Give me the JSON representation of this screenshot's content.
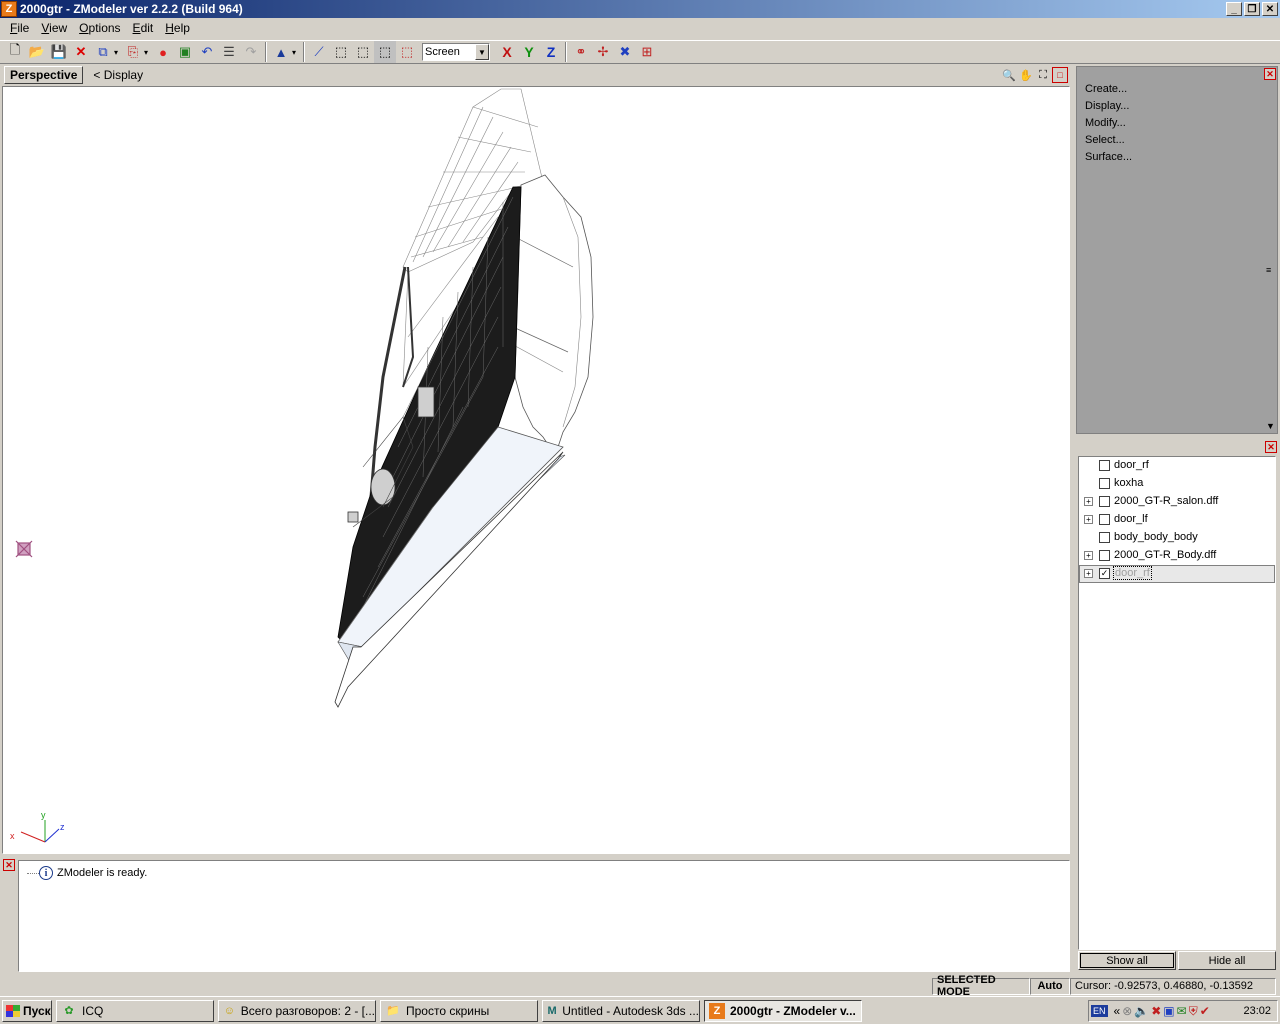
{
  "window": {
    "title": "2000gtr - ZModeler ver 2.2.2 (Build 964)",
    "app_icon": "Z"
  },
  "menu": [
    {
      "label": "File",
      "ul": "F",
      "rest": "ile"
    },
    {
      "label": "View",
      "ul": "V",
      "rest": "iew"
    },
    {
      "label": "Options",
      "ul": "O",
      "rest": "ptions"
    },
    {
      "label": "Edit",
      "ul": "E",
      "rest": "dit"
    },
    {
      "label": "Help",
      "ul": "H",
      "rest": "elp"
    }
  ],
  "toolbar": {
    "projection_select": "Screen",
    "axis_x": "X",
    "axis_y": "Y",
    "axis_z": "Z"
  },
  "viewport": {
    "view_name": "Perspective",
    "display_label": "<  Display",
    "axis_labels": {
      "x": "x",
      "y": "y",
      "z": "z"
    }
  },
  "commands": [
    "Create...",
    "Display...",
    "Modify...",
    "Select...",
    "Surface..."
  ],
  "object_tree": [
    {
      "label": "door_rf",
      "expandable": false,
      "checked": false,
      "selected": false
    },
    {
      "label": "koxha",
      "expandable": false,
      "checked": false,
      "selected": false
    },
    {
      "label": "2000_GT-R_salon.dff",
      "expandable": true,
      "checked": false,
      "selected": false
    },
    {
      "label": "door_lf",
      "expandable": true,
      "checked": false,
      "selected": false
    },
    {
      "label": "body_body_body",
      "expandable": false,
      "checked": false,
      "selected": false
    },
    {
      "label": "2000_GT-R_Body.dff",
      "expandable": true,
      "checked": false,
      "selected": false
    },
    {
      "label": "door_rf",
      "expandable": true,
      "checked": true,
      "selected": true
    }
  ],
  "tree_buttons": {
    "show_all": "Show all",
    "hide_all": "Hide all"
  },
  "log": {
    "message": "ZModeler is ready."
  },
  "status": {
    "mode": "SELECTED MODE",
    "auto": "Auto",
    "cursor": "Cursor: -0.92573, 0.46880, -0.13592"
  },
  "taskbar": {
    "start": "Пуск",
    "tasks": [
      {
        "label": "ICQ",
        "icon": "flower-icon",
        "active": false
      },
      {
        "label": "Всего разговоров: 2 - [...",
        "icon": "chat-icon",
        "active": false
      },
      {
        "label": "Просто скрины",
        "icon": "folder-icon",
        "active": false
      },
      {
        "label": "Untitled - Autodesk 3ds ...",
        "icon": "3ds-icon",
        "active": false
      },
      {
        "label": "2000gtr - ZModeler v...",
        "icon": "zmodeler-icon",
        "active": true
      }
    ],
    "tray_lang": "EN",
    "clock": "23:02"
  }
}
